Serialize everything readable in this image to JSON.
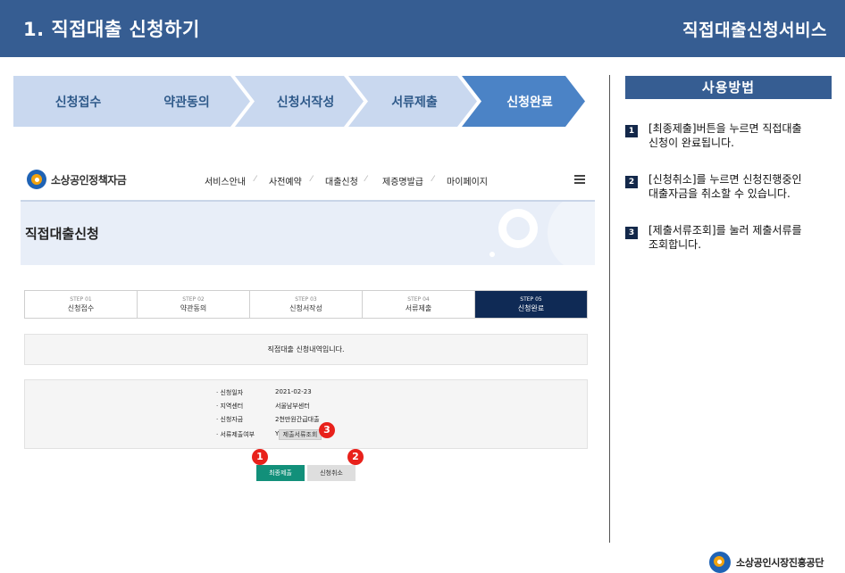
{
  "header": {
    "title": "1. 직접대출 신청하기",
    "service": "직접대출신청서비스"
  },
  "steps": [
    "신청접수",
    "약관동의",
    "신청서작성",
    "서류제출",
    "신청완료"
  ],
  "colors": {
    "header": "#365d92",
    "step_inactive": "#c9d8ef",
    "step_active": "#4b83c6",
    "submit": "#12907a",
    "marker": "#e8211b"
  },
  "site": {
    "logo": "소상공인정책자금",
    "nav": [
      "서비스안내",
      "사전예약",
      "대출신청",
      "제증명발급",
      "마이페이지"
    ],
    "menu_icon": "hamburger-menu-icon",
    "hero_title": "직접대출신청",
    "steps": [
      {
        "no": "STEP 01",
        "name": "신청접수"
      },
      {
        "no": "STEP 02",
        "name": "약관동의"
      },
      {
        "no": "STEP 03",
        "name": "신청서작성"
      },
      {
        "no": "STEP 04",
        "name": "서류제출"
      },
      {
        "no": "STEP 05",
        "name": "신청완료"
      }
    ],
    "notice": "직접대출 신청내역입니다.",
    "info": [
      {
        "label": "· 신청일자",
        "value": "2021-02-23"
      },
      {
        "label": "· 지역센터",
        "value": "서울남부센터"
      },
      {
        "label": "· 신청자금",
        "value": "2천만원간급대출"
      },
      {
        "label": "· 서류제출여부",
        "value": "Y"
      }
    ],
    "doc_button": "제출서류조회",
    "submit_button": "최종제출",
    "cancel_button": "신청취소"
  },
  "markers": [
    "1",
    "2",
    "3"
  ],
  "usage": {
    "title": "사용방법",
    "items": [
      {
        "num": "1",
        "text": "[최종제출]버튼을 누르면 직접대출\n신청이 완료됩니다."
      },
      {
        "num": "2",
        "text": "[신청취소]를 누르면 신청진행중인\n대출자금을 취소할 수 있습니다."
      },
      {
        "num": "3",
        "text": "[제출서류조회]를 눌러 제출서류를\n조회합니다."
      }
    ]
  },
  "footer": {
    "org": "소상공인시장진흥공단"
  }
}
